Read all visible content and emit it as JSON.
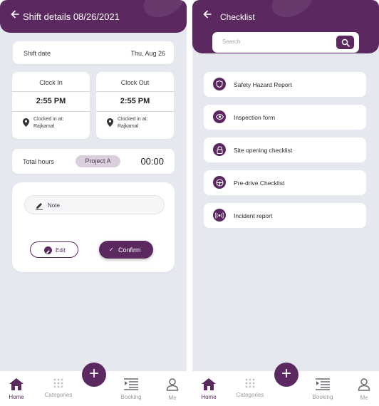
{
  "colors": {
    "primary": "#5b2960",
    "background": "#e6e8f0",
    "badge": "#dccfdd"
  },
  "shift": {
    "title": "Shift details 08/26/2021",
    "shift_date_label": "Shift date",
    "shift_date_value": "Thu, Aug 26",
    "clock_in": {
      "label": "Clock In",
      "time": "2:55 PM",
      "loc_label": "Clocked in at:",
      "loc_value": "Rajkamal"
    },
    "clock_out": {
      "label": "Clock Out",
      "time": "2:55 PM",
      "loc_label": "Clocked in at:",
      "loc_value": "Rajkamal"
    },
    "total_hours_label": "Total hours",
    "project_badge": "Project A",
    "total_hours_value": "00:00",
    "note_label": "Note",
    "edit_label": "Edit",
    "confirm_label": "Confirm"
  },
  "checklist": {
    "title": "Checklist",
    "search_placeholder": "Search",
    "items": [
      {
        "label": "Safety Hazard Report",
        "icon": "shield-icon"
      },
      {
        "label": "Inspection form",
        "icon": "eye-icon"
      },
      {
        "label": "Site opening checklist",
        "icon": "lock-icon"
      },
      {
        "label": "Pre-drive Checklist",
        "icon": "steering-wheel-icon"
      },
      {
        "label": "Incident report",
        "icon": "alert-signal-icon"
      }
    ]
  },
  "tabbar": {
    "home": "Home",
    "categories": "Categories",
    "booking": "Booking",
    "me": "Me",
    "active": "Home"
  }
}
